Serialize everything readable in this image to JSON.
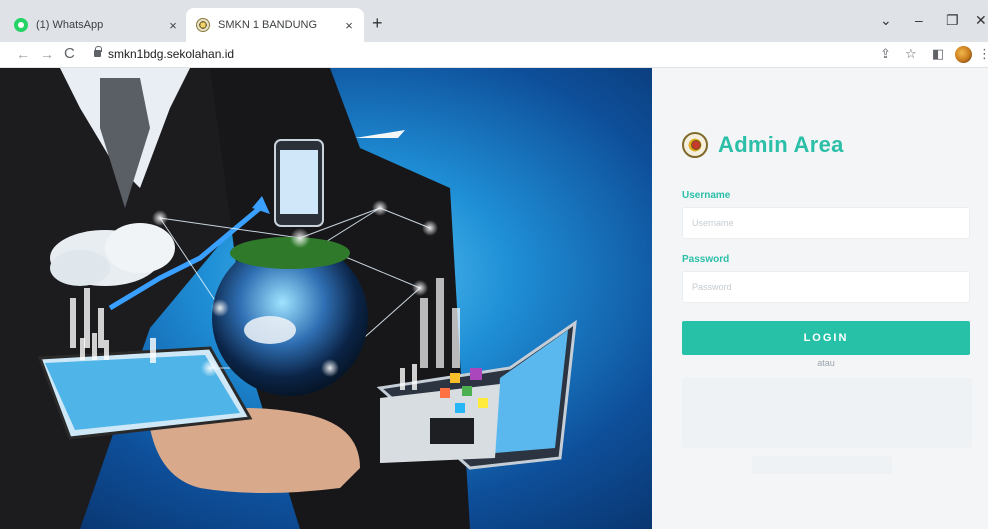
{
  "browser": {
    "tabs": [
      {
        "title": "(1) WhatsApp",
        "close": "×",
        "favicon": "whatsapp-icon"
      },
      {
        "title": "SMKN 1 BANDUNG",
        "close": "×",
        "favicon": "school-logo-icon"
      }
    ],
    "new_tab": "+",
    "window_controls": {
      "dropdown": "⌄",
      "minimize": "–",
      "restore": "❐",
      "close": "✕"
    },
    "nav": {
      "back": "←",
      "forward": "→",
      "reload": "C"
    },
    "url": "smkn1bdg.sekolahan.id",
    "toolbar_icons": {
      "share": "⇪",
      "bookmark": "☆",
      "sidepanel": "◧",
      "menu": "⋮"
    }
  },
  "login": {
    "title": "Admin Area",
    "username_label": "Username",
    "username_placeholder": "Username",
    "username_value": "",
    "password_label": "Password",
    "password_placeholder": "Password",
    "password_value": "",
    "login_button": "LOGIN",
    "or_text": "atau"
  },
  "colors": {
    "accent": "#27c1a8",
    "tabstrip": "#dfe3e8",
    "panel_background": "#f3f5f7"
  }
}
